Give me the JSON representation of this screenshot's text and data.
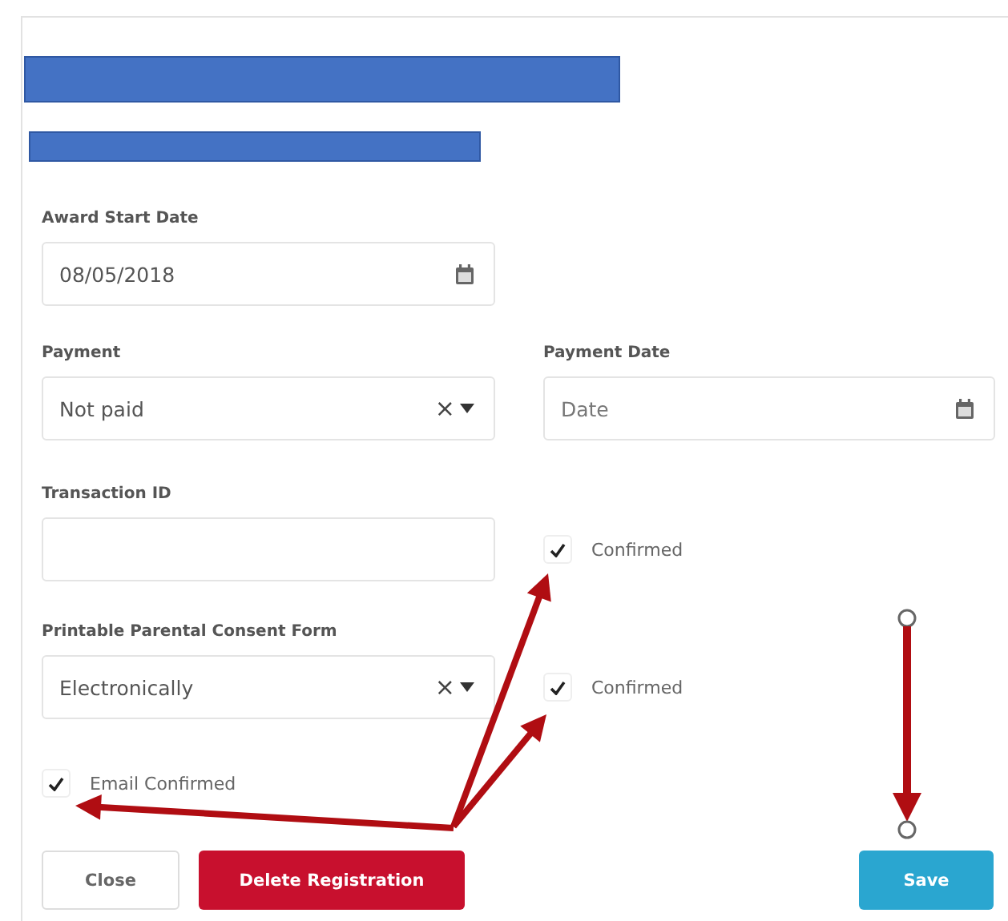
{
  "award_start_date": {
    "label": "Award Start Date",
    "value": "08/05/2018"
  },
  "payment": {
    "label": "Payment",
    "value": "Not paid",
    "clear": "×"
  },
  "payment_date": {
    "label": "Payment Date",
    "placeholder": "Date"
  },
  "transaction_id": {
    "label": "Transaction ID",
    "confirmed": {
      "label": "Confirmed",
      "checked": true
    }
  },
  "consent_form": {
    "label": "Printable Parental Consent Form",
    "value": "Electronically",
    "clear": "×",
    "confirmed": {
      "label": "Confirmed",
      "checked": true
    }
  },
  "email_confirmed": {
    "label": "Email Confirmed",
    "checked": true
  },
  "buttons": [
    {
      "label": "Close",
      "kind": "default"
    },
    {
      "label": "Delete Registration",
      "kind": "danger"
    },
    {
      "label": "Save",
      "kind": "primary"
    }
  ]
}
